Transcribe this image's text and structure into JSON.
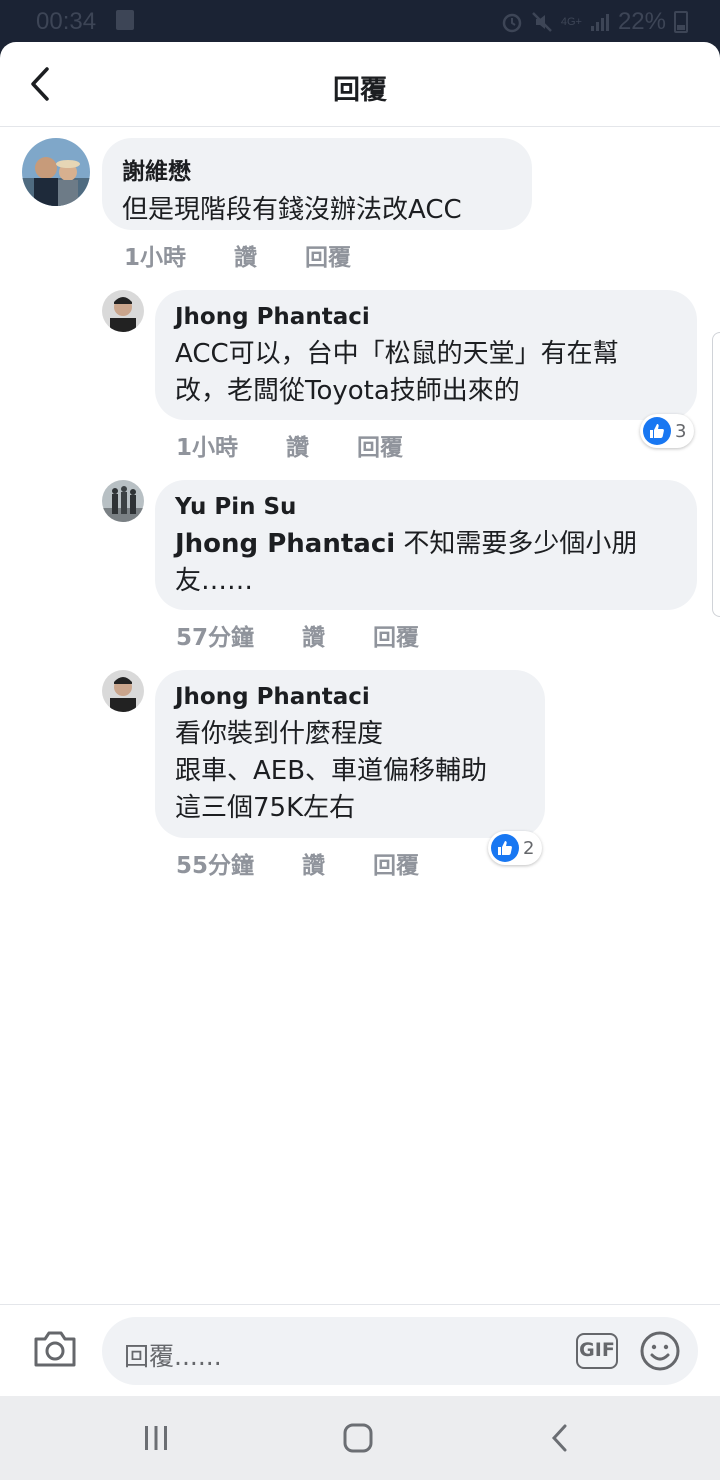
{
  "status_bar": {
    "time": "00:34",
    "network": "4G+",
    "battery": "22%"
  },
  "header": {
    "title": "回覆"
  },
  "comments": [
    {
      "author": "謝維懋",
      "lines": [
        "但是現階段有錢沒辦法改ACC"
      ],
      "time": "1小時",
      "like_label": "讚",
      "reply_label": "回覆"
    },
    {
      "author": "Jhong Phantaci",
      "lines": [
        "ACC可以，台中「松鼠的天堂」有在幫",
        "改，老闆從Toyota技師出來的"
      ],
      "time": "1小時",
      "like_label": "讚",
      "reply_label": "回覆",
      "reactions": "3"
    },
    {
      "author": "Yu Pin Su",
      "mention": "Jhong Phantaci",
      "lines": [
        " 不知需要多少個小朋",
        "友……"
      ],
      "time": "57分鐘",
      "like_label": "讚",
      "reply_label": "回覆"
    },
    {
      "author": "Jhong Phantaci",
      "lines": [
        "看你裝到什麼程度",
        "跟車、AEB、車道偏移輔助",
        "這三個75K左右"
      ],
      "time": "55分鐘",
      "like_label": "讚",
      "reply_label": "回覆",
      "reactions": "2"
    }
  ],
  "composer": {
    "placeholder": "回覆......",
    "gif_label": "GIF"
  },
  "colors": {
    "accent": "#1877f2",
    "bubble": "#f0f2f5",
    "meta": "#90949c"
  }
}
